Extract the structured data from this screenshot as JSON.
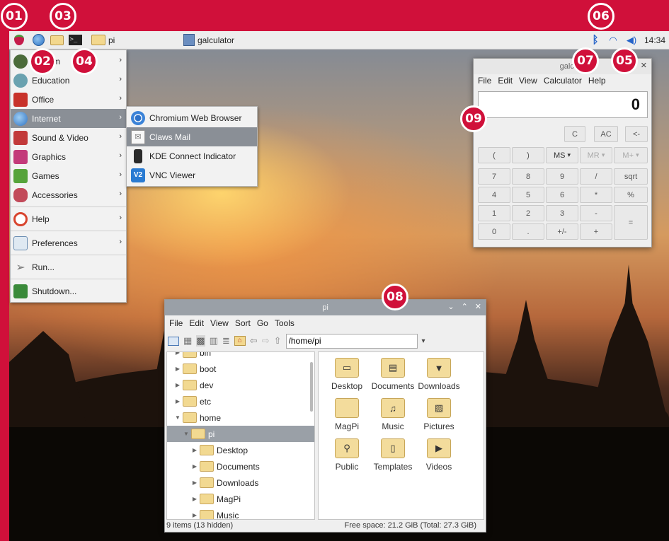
{
  "callouts": [
    "01",
    "02",
    "03",
    "04",
    "05",
    "06",
    "07",
    "08",
    "09"
  ],
  "taskbar": {
    "folder_label": "pi",
    "calculator_label": "galculator",
    "clock": "14:34",
    "icons": [
      "raspberry-icon",
      "web-browser-icon",
      "file-manager-icon",
      "terminal-icon",
      "bluetooth-icon",
      "wifi-icon",
      "volume-icon"
    ]
  },
  "app_menu": {
    "items": [
      {
        "label": "Programming",
        "visible_label": "mm",
        "icon": "programming-icon",
        "submenu": true
      },
      {
        "label": "Education",
        "icon": "education-icon",
        "submenu": true
      },
      {
        "label": "Office",
        "icon": "office-icon",
        "submenu": true
      },
      {
        "label": "Internet",
        "icon": "globe-icon",
        "submenu": true,
        "active": true
      },
      {
        "label": "Sound & Video",
        "icon": "sound-video-icon",
        "submenu": true
      },
      {
        "label": "Graphics",
        "icon": "graphics-icon",
        "submenu": true
      },
      {
        "label": "Games",
        "icon": "games-icon",
        "submenu": true
      },
      {
        "label": "Accessories",
        "icon": "accessories-icon",
        "submenu": true
      },
      {
        "label": "Help",
        "icon": "help-icon",
        "submenu": true
      },
      {
        "label": "Preferences",
        "icon": "preferences-icon",
        "submenu": true
      },
      {
        "label": "Run...",
        "icon": "run-icon",
        "submenu": false
      },
      {
        "label": "Shutdown...",
        "icon": "shutdown-icon",
        "submenu": false
      }
    ]
  },
  "internet_menu": {
    "items": [
      {
        "label": "Chromium Web Browser",
        "icon": "chromium-icon"
      },
      {
        "label": "Claws Mail",
        "icon": "mail-icon",
        "active": true
      },
      {
        "label": "KDE Connect Indicator",
        "icon": "kde-connect-icon"
      },
      {
        "label": "VNC Viewer",
        "icon": "vnc-icon"
      }
    ]
  },
  "calculator": {
    "title": "galculator",
    "menu": [
      "File",
      "Edit",
      "View",
      "Calculator",
      "Help"
    ],
    "display": "0",
    "top_buttons": [
      "C",
      "AC",
      "<-"
    ],
    "memory_buttons": [
      "(",
      ")",
      "MS",
      "MR",
      "M+"
    ],
    "rows": [
      [
        "7",
        "8",
        "9",
        "/",
        "sqrt"
      ],
      [
        "4",
        "5",
        "6",
        "*",
        "%"
      ],
      [
        "1",
        "2",
        "3",
        "-",
        "="
      ],
      [
        "0",
        ".",
        "+/-",
        "+"
      ]
    ]
  },
  "file_manager": {
    "title": "pi",
    "menu": [
      "File",
      "Edit",
      "View",
      "Sort",
      "Go",
      "Tools"
    ],
    "path": "/home/pi",
    "tree": [
      {
        "label": "bin",
        "indent": 0,
        "expander": "collapsed"
      },
      {
        "label": "boot",
        "indent": 0,
        "expander": "collapsed"
      },
      {
        "label": "dev",
        "indent": 0,
        "expander": "collapsed"
      },
      {
        "label": "etc",
        "indent": 0,
        "expander": "collapsed"
      },
      {
        "label": "home",
        "indent": 0,
        "expander": "expanded"
      },
      {
        "label": "pi",
        "indent": 1,
        "expander": "expanded",
        "selected": true
      },
      {
        "label": "Desktop",
        "indent": 2,
        "expander": "collapsed"
      },
      {
        "label": "Documents",
        "indent": 2,
        "expander": "collapsed"
      },
      {
        "label": "Downloads",
        "indent": 2,
        "expander": "collapsed"
      },
      {
        "label": "MagPi",
        "indent": 2,
        "expander": "collapsed"
      },
      {
        "label": "Music",
        "indent": 2,
        "expander": "collapsed"
      }
    ],
    "files": [
      {
        "label": "Desktop",
        "icon": "desktop-folder-icon",
        "glyph": "▭"
      },
      {
        "label": "Documents",
        "icon": "documents-folder-icon",
        "glyph": "▤"
      },
      {
        "label": "Downloads",
        "icon": "downloads-folder-icon",
        "glyph": "▼"
      },
      {
        "label": "MagPi",
        "icon": "folder-icon",
        "glyph": ""
      },
      {
        "label": "Music",
        "icon": "music-folder-icon",
        "glyph": "♫"
      },
      {
        "label": "Pictures",
        "icon": "pictures-folder-icon",
        "glyph": "▨"
      },
      {
        "label": "Public",
        "icon": "public-folder-icon",
        "glyph": "⚲"
      },
      {
        "label": "Templates",
        "icon": "templates-folder-icon",
        "glyph": "▯"
      },
      {
        "label": "Videos",
        "icon": "videos-folder-icon",
        "glyph": "▶"
      }
    ],
    "status_left": "9 items (13 hidden)",
    "status_right": "Free space: 21.2 GiB (Total: 27.3 GiB)"
  },
  "colors": {
    "frame": "#d0103a",
    "menu_active": "#8a8f96",
    "taskbar": "#ededed"
  }
}
